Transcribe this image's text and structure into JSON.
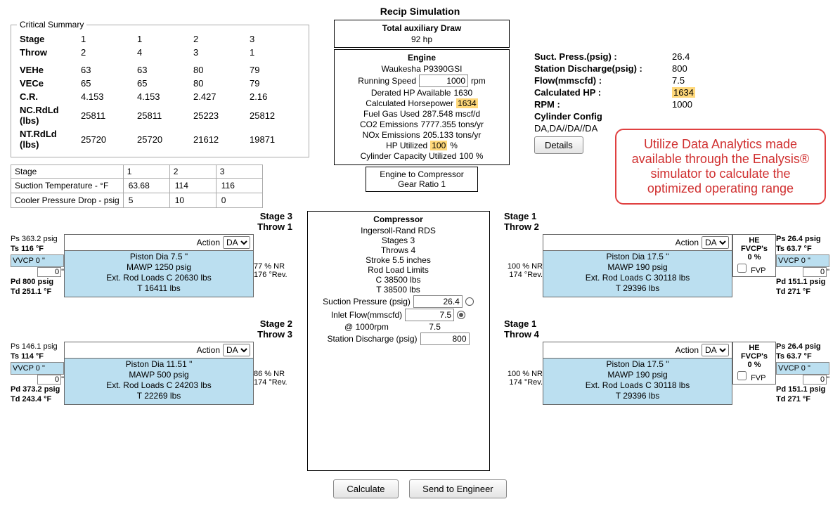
{
  "title": "Recip Simulation",
  "critical": {
    "legend": "Critical Summary",
    "headers": [
      "Stage",
      "1",
      "1",
      "2",
      "3"
    ],
    "throw": [
      "Throw",
      "2",
      "4",
      "3",
      "1"
    ],
    "rows": [
      {
        "label": "VEHe",
        "v": [
          "63",
          "63",
          "80",
          "79"
        ]
      },
      {
        "label": "VECe",
        "v": [
          "65",
          "65",
          "80",
          "79"
        ]
      },
      {
        "label": "C.R.",
        "v": [
          "4.153",
          "4.153",
          "2.427",
          "2.16"
        ]
      },
      {
        "label": "NC.RdLd (lbs)",
        "v": [
          "25811",
          "25811",
          "25223",
          "25812"
        ]
      },
      {
        "label": "NT.RdLd (lbs)",
        "v": [
          "25720",
          "25720",
          "21612",
          "19871"
        ]
      }
    ]
  },
  "stageInputs": {
    "cols": [
      "1",
      "2",
      "3"
    ],
    "suction_label": "Suction Temperature - °F",
    "cooler_label": "Cooler Pressure Drop - psig",
    "suction": [
      "63.68",
      "114",
      "116"
    ],
    "cooler": [
      "5",
      "10",
      "0"
    ]
  },
  "aux": {
    "hdr": "Total auxiliary Draw",
    "val": "92 hp"
  },
  "engine": {
    "hdr": "Engine",
    "model": "Waukesha P9390GSI",
    "speed_label": "Running Speed",
    "speed_val": "1000",
    "speed_unit": "rpm",
    "derated_label": "Derated HP Available",
    "derated_val": "1630",
    "calc_hp_label": "Calculated Horsepower",
    "calc_hp_val": "1634",
    "fuel_label": "Fuel Gas Used",
    "fuel_val": "287.548 mscf/d",
    "co2_label": "CO2 Emissions",
    "co2_val": "7777.355 tons/yr",
    "nox_label": "NOx Emissions",
    "nox_val": "205.133 tons/yr",
    "hp_util_label": "HP Utilized",
    "hp_util_val": "100",
    "cyl_util_label": "Cylinder Capacity Utilized",
    "cyl_util_val": "100 %"
  },
  "gear": {
    "l1": "Engine to Compressor",
    "l2": "Gear Ratio 1"
  },
  "compressor": {
    "hdr": "Compressor",
    "model": "Ingersoll-Rand RDS",
    "stages": "Stages 3",
    "throws": "Throws 4",
    "stroke": "Stroke 5.5 inches",
    "rll_hdr": "Rod Load Limits",
    "rll_c": "C 38500 lbs",
    "rll_t": "T 38500 lbs",
    "sp_label": "Suction Pressure (psig)",
    "sp_val": "26.4",
    "if_label": "Inlet Flow(mmscfd)",
    "if_val": "7.5",
    "at_rpm": "@ 1000rpm",
    "at_rpm_val": "7.5",
    "sd_label": "Station Discharge (psig)",
    "sd_val": "800"
  },
  "summary": {
    "rows": [
      {
        "k": "Suct. Press.(psig) :",
        "v": "26.4"
      },
      {
        "k": "Station Discharge(psig) :",
        "v": "800"
      },
      {
        "k": "Flow(mmscfd) :",
        "v": "7.5"
      },
      {
        "k": "Calculated HP :",
        "v": "1634",
        "hl": true
      },
      {
        "k": "RPM :",
        "v": "1000"
      },
      {
        "k": "Cylinder Config",
        "v": ""
      }
    ],
    "config": "DA,DA//DA//DA",
    "details": "Details"
  },
  "callout": "Utilize Data Analytics made available through the Enalysis® simulator to calculate the optimized operating range",
  "throws": {
    "left": [
      {
        "title1": "Stage 3",
        "title2": "Throw 1",
        "side": {
          "ps": "Ps 363.2 psig",
          "ts": "Ts 116 °F",
          "vvcp": "VVCP 0 \"",
          "in": "0",
          "unit": "\"",
          "pd": "Pd 800 psig",
          "td": "Td 251.1 °F"
        },
        "action": "DA",
        "piston": "Piston Dia 7.5 \"",
        "mawp": "MAWP  1250 psig",
        "ext": "Ext. Rod Loads C 20630 lbs",
        "ext_t": "T 16411 lbs",
        "nr": "77 % NR",
        "rev": "176 °Rev."
      },
      {
        "title1": "Stage 2",
        "title2": "Throw 3",
        "side": {
          "ps": "Ps 146.1 psig",
          "ts": "Ts 114 °F",
          "vvcp": "VVCP 0 \"",
          "in": "0",
          "unit": "\"",
          "pd": "Pd 373.2 psig",
          "td": "Td 243.4 °F"
        },
        "action": "DA",
        "piston": "Piston Dia 11.51 \"",
        "mawp": "MAWP  500 psig",
        "ext": "Ext. Rod Loads C 24203 lbs",
        "ext_t": "T 22269 lbs",
        "nr": "86 % NR",
        "rev": "174 °Rev."
      }
    ],
    "right": [
      {
        "title1": "Stage 1",
        "title2": "Throw 2",
        "side": {
          "ps": "Ps 26.4 psig",
          "ts": "Ts 63.7 °F",
          "vvcp": "VVCP 0 \"",
          "in": "0",
          "unit": "\"",
          "pd": "Pd 151.1 psig",
          "td": "Td 271 °F"
        },
        "fvcp_hdr": "HE FVCP's",
        "fvcp_pct": "0 %",
        "fvcp_lbl": "FVP",
        "action": "DA",
        "piston": "Piston Dia 17.5 \"",
        "mawp": "MAWP  190 psig",
        "ext": "Ext. Rod Loads C 30118 lbs",
        "ext_t": "T 29396 lbs",
        "nr": "100 % NR",
        "rev": "174 °Rev."
      },
      {
        "title1": "Stage 1",
        "title2": "Throw 4",
        "side": {
          "ps": "Ps 26.4 psig",
          "ts": "Ts 63.7 °F",
          "vvcp": "VVCP 0 \"",
          "in": "0",
          "unit": "\"",
          "pd": "Pd 151.1 psig",
          "td": "Td 271 °F"
        },
        "fvcp_hdr": "HE FVCP's",
        "fvcp_pct": "0 %",
        "fvcp_lbl": "FVP",
        "action": "DA",
        "piston": "Piston Dia 17.5 \"",
        "mawp": "MAWP  190 psig",
        "ext": "Ext. Rod Loads C 30118 lbs",
        "ext_t": "T 29396 lbs",
        "nr": "100 % NR",
        "rev": "174 °Rev."
      }
    ]
  },
  "labels": {
    "stage": "Stage",
    "action": "Action",
    "pct": "%"
  },
  "buttons": {
    "calculate": "Calculate",
    "send": "Send to Engineer"
  }
}
